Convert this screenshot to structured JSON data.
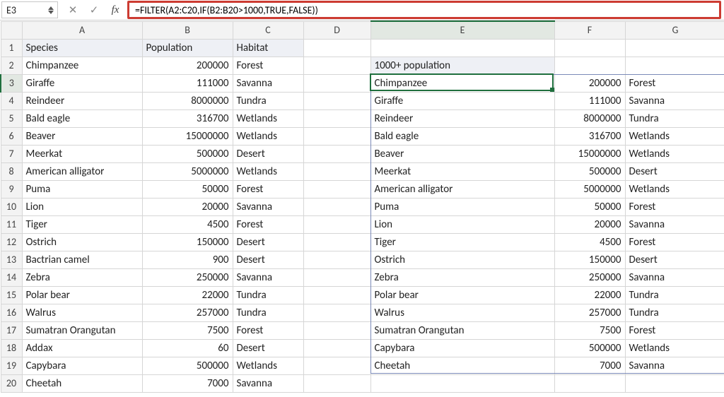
{
  "formula_bar": {
    "cell_ref": "E3",
    "cancel_glyph": "✕",
    "accept_glyph": "✓",
    "fx_label": "fx",
    "formula": "=FILTER(A2:C20,IF(B2:B20>1000,TRUE,FALSE))"
  },
  "columns": [
    "A",
    "B",
    "C",
    "D",
    "E",
    "F",
    "G"
  ],
  "row_count": 20,
  "headers": {
    "A": "Species",
    "B": "Population",
    "C": "Habitat"
  },
  "source_table": [
    {
      "species": "Chimpanzee",
      "population": 200000,
      "habitat": "Forest"
    },
    {
      "species": "Giraffe",
      "population": 111000,
      "habitat": "Savanna"
    },
    {
      "species": "Reindeer",
      "population": 8000000,
      "habitat": "Tundra"
    },
    {
      "species": "Bald eagle",
      "population": 316700,
      "habitat": "Wetlands"
    },
    {
      "species": "Beaver",
      "population": 15000000,
      "habitat": "Wetlands"
    },
    {
      "species": "Meerkat",
      "population": 500000,
      "habitat": "Desert"
    },
    {
      "species": "American alligator",
      "population": 5000000,
      "habitat": "Wetlands"
    },
    {
      "species": "Puma",
      "population": 50000,
      "habitat": "Forest"
    },
    {
      "species": "Lion",
      "population": 20000,
      "habitat": "Savanna"
    },
    {
      "species": "Tiger",
      "population": 4500,
      "habitat": "Forest"
    },
    {
      "species": "Ostrich",
      "population": 150000,
      "habitat": "Desert"
    },
    {
      "species": "Bactrian camel",
      "population": 900,
      "habitat": "Desert"
    },
    {
      "species": "Zebra",
      "population": 250000,
      "habitat": "Savanna"
    },
    {
      "species": "Polar bear",
      "population": 22000,
      "habitat": "Tundra"
    },
    {
      "species": "Walrus",
      "population": 257000,
      "habitat": "Tundra"
    },
    {
      "species": "Sumatran Orangutan",
      "population": 7500,
      "habitat": "Forest"
    },
    {
      "species": "Addax",
      "population": 60,
      "habitat": "Desert"
    },
    {
      "species": "Capybara",
      "population": 500000,
      "habitat": "Wetlands"
    },
    {
      "species": "Cheetah",
      "population": 7000,
      "habitat": "Savanna"
    }
  ],
  "result_header": "1000+ population",
  "result_table": [
    {
      "species": "Chimpanzee",
      "population": 200000,
      "habitat": "Forest"
    },
    {
      "species": "Giraffe",
      "population": 111000,
      "habitat": "Savanna"
    },
    {
      "species": "Reindeer",
      "population": 8000000,
      "habitat": "Tundra"
    },
    {
      "species": "Bald eagle",
      "population": 316700,
      "habitat": "Wetlands"
    },
    {
      "species": "Beaver",
      "population": 15000000,
      "habitat": "Wetlands"
    },
    {
      "species": "Meerkat",
      "population": 500000,
      "habitat": "Desert"
    },
    {
      "species": "American alligator",
      "population": 5000000,
      "habitat": "Wetlands"
    },
    {
      "species": "Puma",
      "population": 50000,
      "habitat": "Forest"
    },
    {
      "species": "Lion",
      "population": 20000,
      "habitat": "Savanna"
    },
    {
      "species": "Tiger",
      "population": 4500,
      "habitat": "Forest"
    },
    {
      "species": "Ostrich",
      "population": 150000,
      "habitat": "Desert"
    },
    {
      "species": "Zebra",
      "population": 250000,
      "habitat": "Savanna"
    },
    {
      "species": "Polar bear",
      "population": 22000,
      "habitat": "Tundra"
    },
    {
      "species": "Walrus",
      "population": 257000,
      "habitat": "Tundra"
    },
    {
      "species": "Sumatran Orangutan",
      "population": 7500,
      "habitat": "Forest"
    },
    {
      "species": "Capybara",
      "population": 500000,
      "habitat": "Wetlands"
    },
    {
      "species": "Cheetah",
      "population": 7000,
      "habitat": "Savanna"
    }
  ],
  "active_cell": {
    "col": "E",
    "row": 3
  },
  "spill_range": {
    "from": {
      "col": "E",
      "row": 3
    },
    "to": {
      "col": "G",
      "row": 19
    }
  }
}
